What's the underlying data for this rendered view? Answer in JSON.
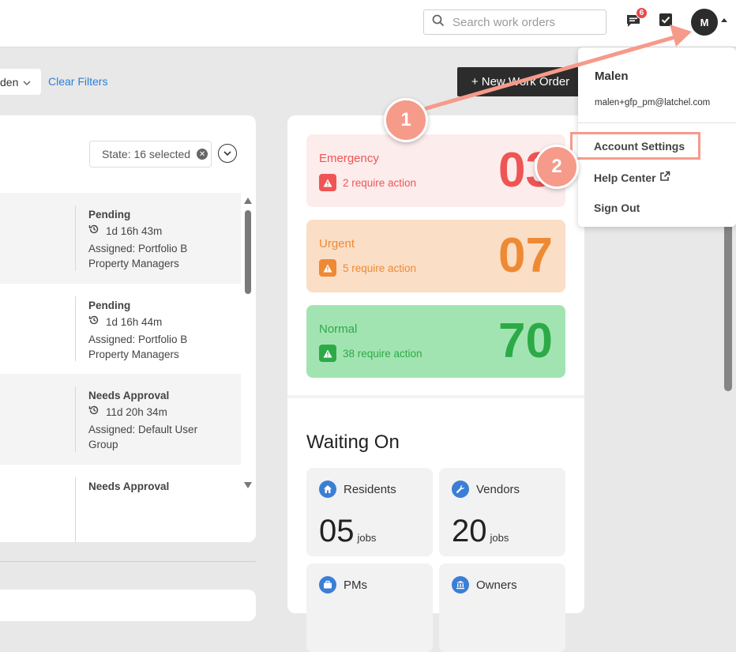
{
  "topbar": {
    "search_placeholder": "Search work orders",
    "chat_badge": "6",
    "avatar_initial": "M"
  },
  "filters": {
    "chip_label": "den",
    "clear_label": "Clear Filters",
    "new_work_order_label": "+ New Work Order"
  },
  "work_list": {
    "state_filter_label": "State: 16 selected",
    "rows": [
      {
        "status": "Pending",
        "time": "1d 16h 43m",
        "assigned": "Assigned: Portfolio B Property Managers"
      },
      {
        "status": "Pending",
        "time": "1d 16h 44m",
        "assigned": "Assigned: Portfolio B Property Managers"
      },
      {
        "status": "Needs Approval",
        "time": "11d 20h 34m",
        "assigned": "Assigned: Default User Group"
      },
      {
        "status": "Needs Approval",
        "time": "",
        "assigned": ""
      }
    ]
  },
  "priorities": {
    "emergency": {
      "label": "Emergency",
      "action": "2 require action",
      "count": "03"
    },
    "urgent": {
      "label": "Urgent",
      "action": "5 require action",
      "count": "07"
    },
    "normal": {
      "label": "Normal",
      "action": "38 require action",
      "count": "70"
    }
  },
  "waiting_on": {
    "title": "Waiting On",
    "residents": {
      "label": "Residents",
      "count": "05",
      "unit": "jobs"
    },
    "vendors": {
      "label": "Vendors",
      "count": "20",
      "unit": "jobs"
    },
    "pms": {
      "label": "PMs"
    },
    "owners": {
      "label": "Owners"
    }
  },
  "user_menu": {
    "name": "Malen",
    "email": "malen+gfp_pm@latchel.com",
    "account_settings": "Account Settings",
    "help_center": "Help Center",
    "sign_out": "Sign Out"
  },
  "annotations": {
    "step1": "1",
    "step2": "2",
    "accent_color": "#f69a8a"
  },
  "colors": {
    "emergency": "#ee5555",
    "urgent": "#ee8a34",
    "normal": "#2daa48",
    "link": "#2f7ed8",
    "icon_blue": "#3a7fd5"
  }
}
